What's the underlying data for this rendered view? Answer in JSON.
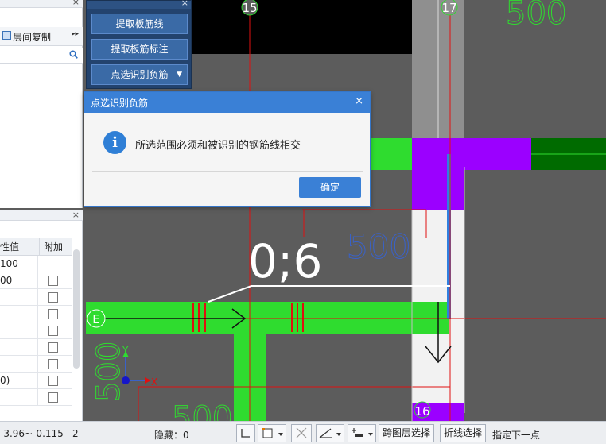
{
  "left_panel_top": {
    "close_glyph": "×",
    "toolbar_label": "层间复制",
    "more_glyph": "▸▸"
  },
  "left_panel_bottom": {
    "close_glyph": "×",
    "col_value": "性值",
    "col_extra": "附加",
    "rows": [
      {
        "value": "100",
        "has_checkbox": false
      },
      {
        "value": "00",
        "has_checkbox": true
      },
      {
        "value": "",
        "has_checkbox": true
      },
      {
        "value": "",
        "has_checkbox": true
      },
      {
        "value": "",
        "has_checkbox": true
      },
      {
        "value": "",
        "has_checkbox": true
      },
      {
        "value": "",
        "has_checkbox": true
      },
      {
        "value": "0)",
        "has_checkbox": true
      },
      {
        "value": "",
        "has_checkbox": true
      }
    ]
  },
  "button_panel": {
    "close_glyph": "×",
    "btn1": "提取板筋线",
    "btn2": "提取板筋标注",
    "btn3": "点选识别负筋",
    "btn3_arrow": "▼"
  },
  "canvas": {
    "axis_15": "15",
    "axis_17": "17",
    "axis_16": "16",
    "axis_E": "E",
    "dim_500_top": "500",
    "dim_500_mid": "500",
    "dim_500_left": "500",
    "dim_500_bottom": "500",
    "rebar_label": "0;6",
    "ucs_x": "X",
    "ucs_y": "Y"
  },
  "dialog": {
    "title": "点选识别负筋",
    "close_glyph": "×",
    "message": "所选范围必须和被识别的钢筋线相交",
    "ok_label": "确定"
  },
  "statusbar": {
    "coords": "-3.96~-0.115",
    "count": "2",
    "hidden_label": "隐藏：0",
    "cross_layer": "跨图层选择",
    "polyline": "折线选择",
    "prompt": "指定下一点"
  },
  "colors": {
    "slab_green": "#2fdc2f",
    "beam_purple": "#9b00ff",
    "dark_green": "#006b00",
    "axis_red": "#e01010",
    "dim_blue": "#3a62c8",
    "dialog_blue": "#3a80d6"
  }
}
